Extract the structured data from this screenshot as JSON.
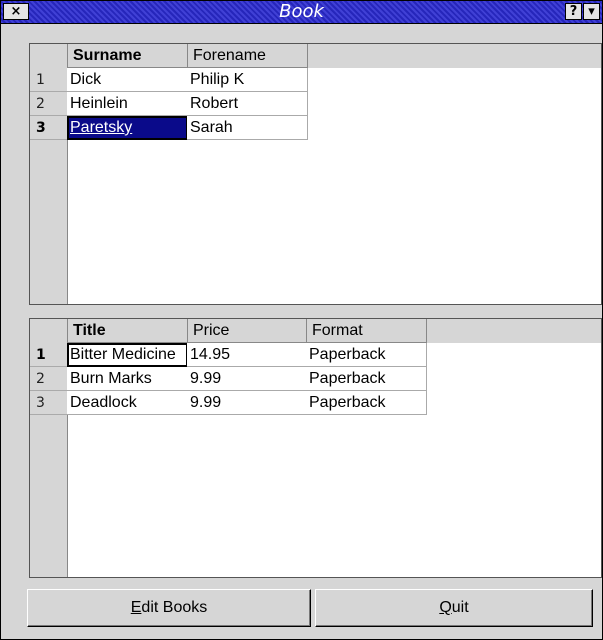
{
  "window": {
    "title": "Book",
    "close_glyph": "×",
    "help_glyph": "?",
    "menu_glyph": "▾"
  },
  "authors": {
    "headers": [
      "Surname",
      "Forename"
    ],
    "rows": [
      {
        "num": "1",
        "surname": "Dick",
        "forename": "Philip K"
      },
      {
        "num": "2",
        "surname": "Heinlein",
        "forename": "Robert"
      },
      {
        "num": "3",
        "surname": "Paretsky",
        "forename": "Sarah"
      }
    ]
  },
  "books": {
    "headers": [
      "Title",
      "Price",
      "Format"
    ],
    "rows": [
      {
        "num": "1",
        "title": "Bitter Medicine",
        "price": "14.95",
        "format": "Paperback"
      },
      {
        "num": "2",
        "title": "Burn Marks",
        "price": "9.99",
        "format": "Paperback"
      },
      {
        "num": "3",
        "title": "Deadlock",
        "price": "9.99",
        "format": "Paperback"
      }
    ]
  },
  "buttons": {
    "edit_first": "E",
    "edit_rest": "dit Books",
    "quit_first": "Q",
    "quit_rest": "uit"
  },
  "colors": {
    "titlebar": "#2a2ad0",
    "selection": "#0a0a8a"
  }
}
